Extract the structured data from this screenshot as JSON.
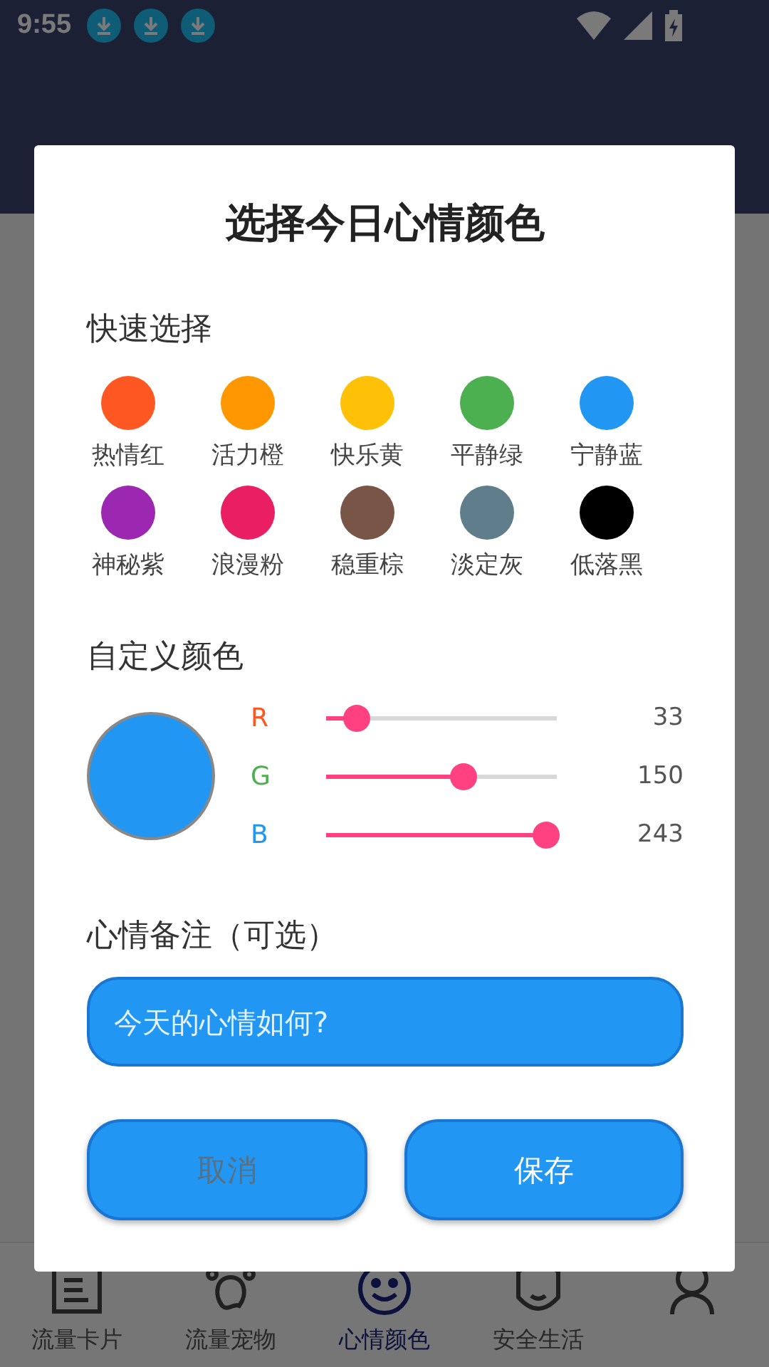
{
  "status_bar": {
    "time": "9:55",
    "notifications": [
      {
        "kind": "download"
      },
      {
        "kind": "download"
      },
      {
        "kind": "download"
      }
    ]
  },
  "nav": [
    {
      "label": "流量卡片",
      "selected": false
    },
    {
      "label": "流量宠物",
      "selected": false
    },
    {
      "label": "心情颜色",
      "selected": true
    },
    {
      "label": "安全生活",
      "selected": false
    },
    {
      "selected": false
    }
  ],
  "dialog": {
    "title": "选择今日心情颜色",
    "quick_title": "快速选择",
    "swatches": [
      {
        "label": "热情红",
        "color": "#ff5722"
      },
      {
        "label": "活力橙",
        "color": "#ff9800"
      },
      {
        "label": "快乐黄",
        "color": "#ffc107"
      },
      {
        "label": "平静绿",
        "color": "#4caf50"
      },
      {
        "label": "宁静蓝",
        "color": "#2196f3"
      },
      {
        "label": "神秘紫",
        "color": "#9c27b0"
      },
      {
        "label": "浪漫粉",
        "color": "#e91e63"
      },
      {
        "label": "稳重棕",
        "color": "#795548"
      },
      {
        "label": "淡定灰",
        "color": "#607d8b"
      },
      {
        "label": "低落黑",
        "color": "#000000"
      }
    ],
    "custom_title": "自定义颜色",
    "channels": [
      {
        "name": "R",
        "color": "#ff5722",
        "level": 0.13,
        "reading": "33"
      },
      {
        "name": "G",
        "color": "#4caf50",
        "level": 0.59,
        "reading": "150"
      },
      {
        "name": "B",
        "color": "#2196f3",
        "level": 0.95,
        "reading": "243"
      }
    ],
    "note_title": "心情备注（可选）",
    "note": {
      "placeholder": "今天的心情如何?"
    },
    "buttons": [
      {
        "label": "取消",
        "kind": "cancel"
      },
      {
        "label": "保存",
        "kind": "save"
      }
    ]
  }
}
